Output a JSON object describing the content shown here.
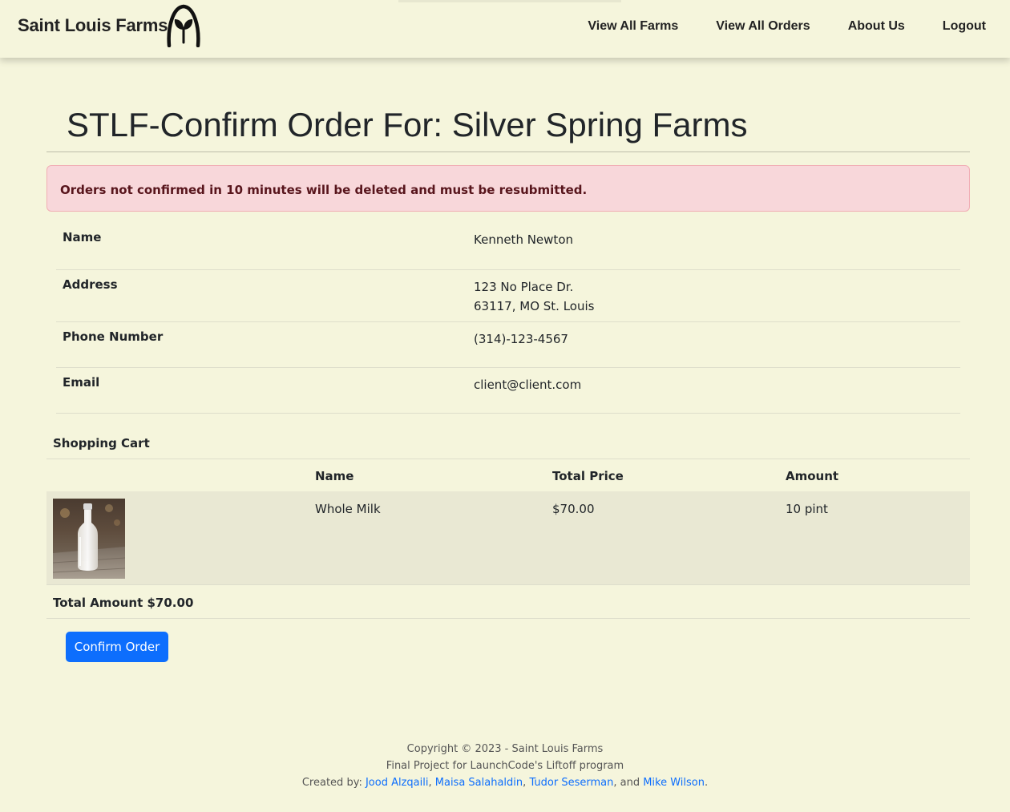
{
  "navbar": {
    "brand": "Saint Louis Farms",
    "links": [
      "View All Farms",
      "View All Orders",
      "About Us",
      "Logout"
    ]
  },
  "page": {
    "title": "STLF-Confirm Order For: Silver Spring Farms",
    "alert": "Orders not confirmed in 10 minutes will be deleted and must be resubmitted."
  },
  "customer": {
    "name_label": "Name",
    "name": "Kenneth Newton",
    "address_label": "Address",
    "address_line1": "123 No Place Dr.",
    "address_line2": "63117, MO St. Louis",
    "phone_label": "Phone Number",
    "phone": "(314)-123-4567",
    "email_label": "Email",
    "email": "client@client.com"
  },
  "cart": {
    "heading": "Shopping Cart",
    "columns": [
      "Name",
      "Total Price",
      "Amount"
    ],
    "items": [
      {
        "name": "Whole Milk",
        "total_price": "$70.00",
        "amount": "10 pint",
        "image": "milk-bottle-photo"
      }
    ],
    "total": "Total Amount $70.00",
    "confirm_label": "Confirm Order"
  },
  "footer": {
    "copyright": "Copyright © 2023 - Saint Louis Farms",
    "project": "Final Project for LaunchCode's Liftoff program",
    "created_by": "Created by:",
    "authors": [
      "Jood Alzqaili",
      "Maisa Salahaldin",
      "Tudor Seserman",
      "Mike Wilson"
    ],
    "sep1": ",",
    "sep2": ",",
    "sep3": ", and",
    "end": "."
  },
  "colors": {
    "background": "#f5f5dc",
    "alert_bg": "#f8d7da",
    "alert_text": "#58151c",
    "button": "#0d6efd",
    "link": "#0d6efd"
  }
}
